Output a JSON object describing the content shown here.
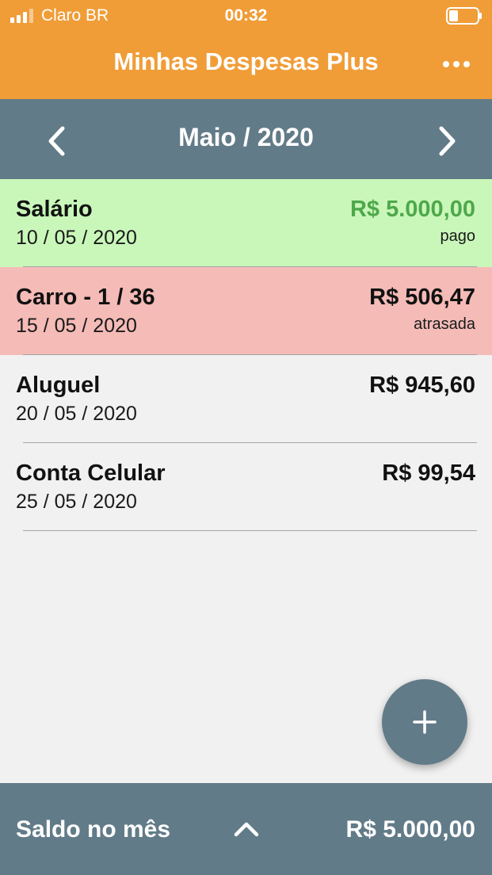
{
  "status_bar": {
    "carrier": "Claro BR",
    "time": "00:32",
    "signal_icon": "signal-bars-icon",
    "battery_icon": "battery-icon"
  },
  "header": {
    "title": "Minhas Despesas Plus",
    "more_icon": "more-horizontal-icon"
  },
  "month_nav": {
    "label": "Maio / 2020",
    "prev_icon": "chevron-left-icon",
    "next_icon": "chevron-right-icon"
  },
  "entries": [
    {
      "name": "Salário",
      "date": "10 / 05 / 2020",
      "amount": "R$ 5.000,00",
      "status": "pago"
    },
    {
      "name": "Carro - 1 / 36",
      "date": "15 / 05 / 2020",
      "amount": "R$ 506,47",
      "status": "atrasada"
    },
    {
      "name": "Aluguel",
      "date": "20 / 05 / 2020",
      "amount": "R$ 945,60",
      "status": ""
    },
    {
      "name": "Conta Celular",
      "date": "25 / 05 / 2020",
      "amount": "R$ 99,54",
      "status": ""
    }
  ],
  "fab": {
    "icon": "plus-icon"
  },
  "footer": {
    "label": "Saldo no mês",
    "value": "R$ 5.000,00",
    "expand_icon": "chevron-up-icon"
  },
  "colors": {
    "header": "#f09d38",
    "bar": "#627b88",
    "paid_row": "#c9f7ba",
    "late_row": "#f4bbb7",
    "paid_amount": "#4ea84a",
    "background": "#f1f1f1"
  }
}
